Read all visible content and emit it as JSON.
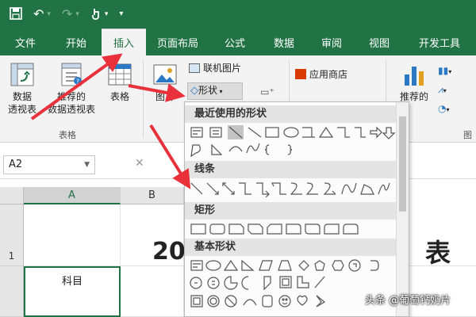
{
  "colors": {
    "brand": "#217346",
    "arrow": "#e8313b",
    "shape_outline": "#555555"
  },
  "quick_access": [
    "save-icon",
    "undo-icon",
    "redo-icon",
    "touch-mode-icon",
    "customize-icon"
  ],
  "tabs": [
    {
      "label": "文件",
      "w": 64
    },
    {
      "label": "开始",
      "w": 64
    },
    {
      "label": "插入",
      "w": 56,
      "active": true
    },
    {
      "label": "页面布局",
      "w": 80
    },
    {
      "label": "公式",
      "w": 64
    },
    {
      "label": "数据",
      "w": 60
    },
    {
      "label": "审阅",
      "w": 60
    },
    {
      "label": "视图",
      "w": 60
    },
    {
      "label": "开发工具",
      "w": 92
    }
  ],
  "ribbon": {
    "pivot_table": "数据\n透视表",
    "recommended_pivot": "推荐的\n数据透视表",
    "table": "表格",
    "group_tables": "表格",
    "picture": "图片",
    "online_picture": "联机图片",
    "shapes": "形状",
    "store": "应用商店",
    "recommended_charts": "推荐的",
    "group_partial": "图"
  },
  "name_box": "A2",
  "columns": [
    {
      "label": "A",
      "selected": true
    },
    {
      "label": "B"
    }
  ],
  "rows": [
    {
      "label": "1"
    }
  ],
  "cells": {
    "title_left": "20",
    "title_right": "表",
    "a2": "科目"
  },
  "shapes_menu": {
    "sections": [
      {
        "title": "最近使用的形状"
      },
      {
        "title": "线条"
      },
      {
        "title": "矩形"
      },
      {
        "title": "基本形状"
      }
    ]
  },
  "watermark": "头条 @葡萄钙奶片"
}
